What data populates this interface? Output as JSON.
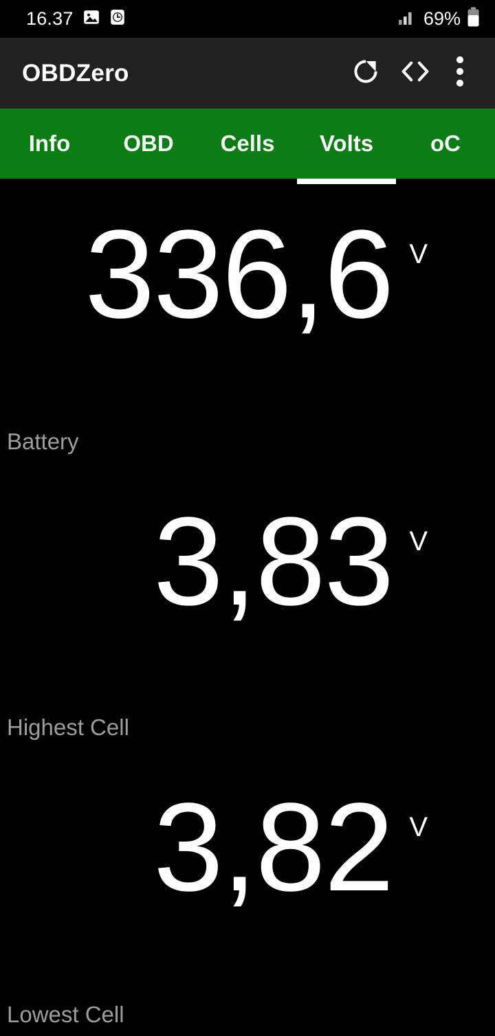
{
  "status_bar": {
    "clock": "16.37",
    "icons": [
      "image-icon",
      "alarm-icon"
    ],
    "signal_icon": "signal-bars-icon",
    "battery_percent": "69%",
    "battery_icon": "battery-icon"
  },
  "app_bar": {
    "title": "OBDZero",
    "actions": [
      {
        "name": "refresh-button",
        "icon": "refresh-icon"
      },
      {
        "name": "code-button",
        "icon": "code-brackets-icon"
      },
      {
        "name": "overflow-menu-button",
        "icon": "more-vertical-icon"
      }
    ]
  },
  "tabs": {
    "active_index": 3,
    "items": [
      {
        "label": "Info"
      },
      {
        "label": "OBD"
      },
      {
        "label": "Cells"
      },
      {
        "label": "Volts"
      },
      {
        "label": "oC"
      }
    ]
  },
  "metrics": [
    {
      "value": "336,6",
      "unit": "V",
      "label": "Battery"
    },
    {
      "value": "3,83",
      "unit": "V",
      "label": "Highest Cell"
    },
    {
      "value": "3,82",
      "unit": "V",
      "label": "Lowest Cell"
    }
  ],
  "colors": {
    "accent_green": "#0b7d14",
    "app_bar": "#212121",
    "background": "#000000",
    "label_gray": "#9e9e9e",
    "value_white": "#ffffff"
  }
}
